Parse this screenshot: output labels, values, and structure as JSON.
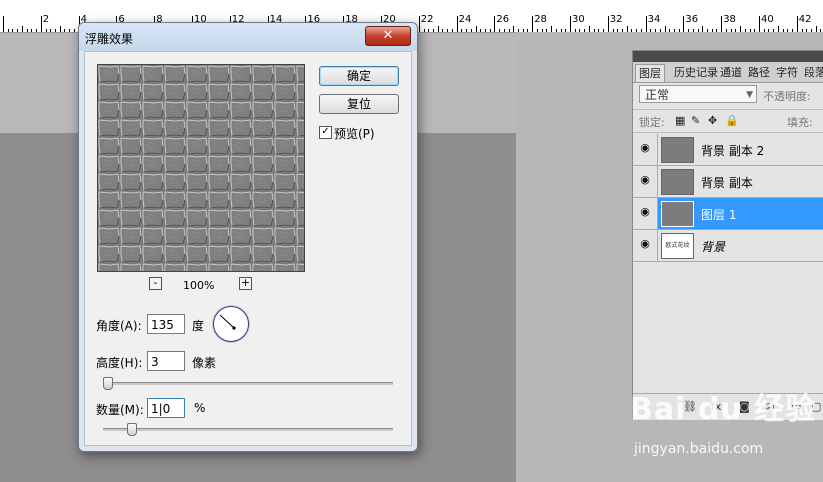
{
  "ruler": {
    "labels": [
      "2",
      "4",
      "6",
      "8",
      "10",
      "12",
      "14",
      "16",
      "18",
      "20",
      "22",
      "24",
      "26",
      "28",
      "30",
      "32",
      "34",
      "36",
      "38",
      "40",
      "42"
    ]
  },
  "dialog": {
    "title": "浮雕效果",
    "close": "✕",
    "ok": "确定",
    "reset": "复位",
    "preview_checked": "✓",
    "preview_label": "预览(P)",
    "zoom_minus": "-",
    "zoom_plus": "+",
    "zoom": "100%",
    "angle_label": "角度(A):",
    "angle_value": "135",
    "angle_unit": "度",
    "height_label": "高度(H):",
    "height_value": "3",
    "height_unit": "像素",
    "amount_label": "数量(M):",
    "amount_value": "1|0",
    "amount_unit": "%"
  },
  "layers_panel": {
    "tabs": [
      "图层",
      "历史记录",
      "通道",
      "路径",
      "字符",
      "段落"
    ],
    "blend_mode": "正常",
    "opacity_label": "不透明度:",
    "lock_label": "锁定:",
    "fill_label": "填充:",
    "layers": [
      {
        "name": "背景 副本 2",
        "selected": false
      },
      {
        "name": "背景 副本",
        "selected": false
      },
      {
        "name": "图层 1",
        "selected": true
      },
      {
        "name": "背景",
        "selected": false
      }
    ],
    "background_thumb_text": "欧式花纹"
  },
  "watermark": {
    "brand": "Bai du 经验",
    "url": "jingyan.baidu.com"
  }
}
